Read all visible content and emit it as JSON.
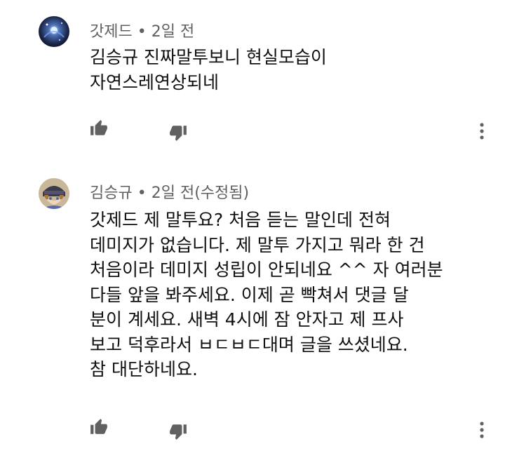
{
  "comments": [
    {
      "author": "갓제드",
      "separator": "•",
      "time": "2일 전",
      "edited": "",
      "text": "김승규 진짜말투보니 현실모습이\n자연스레연상되네",
      "avatar_icon": "space-avatar-icon",
      "colors": {
        "avatar_bg": "#1d2a4a"
      }
    },
    {
      "author": "김승규",
      "separator": "•",
      "time": "2일 전",
      "edited": "(수정됨)",
      "text": "갓제드 제 말투요? 처음 듣는 말인데 전혀\n데미지가 없습니다. 제 말투 가지고 뭐라 한 건\n처음이라 데미지 성립이 안되네요 ^^ 자 여러분\n다들 앞을 봐주세요. 이제 곧 빡쳐서 댓글 달\n분이 계세요. 새벽 4시에 잠 안자고 제 프사\n보고 덕후라서 ㅂㄷㅂㄷ대며 글을 쓰셨네요.\n참 대단하네요.",
      "avatar_icon": "anime-character-avatar-icon",
      "colors": {
        "avatar_bg": "#8a6a4a"
      }
    }
  ],
  "icons": {
    "like": "thumbs-up-icon",
    "dislike": "thumbs-down-icon",
    "more": "more-vert-icon"
  },
  "colors": {
    "meta": "#606060",
    "icon": "#606060",
    "text": "#0f0f0f"
  }
}
